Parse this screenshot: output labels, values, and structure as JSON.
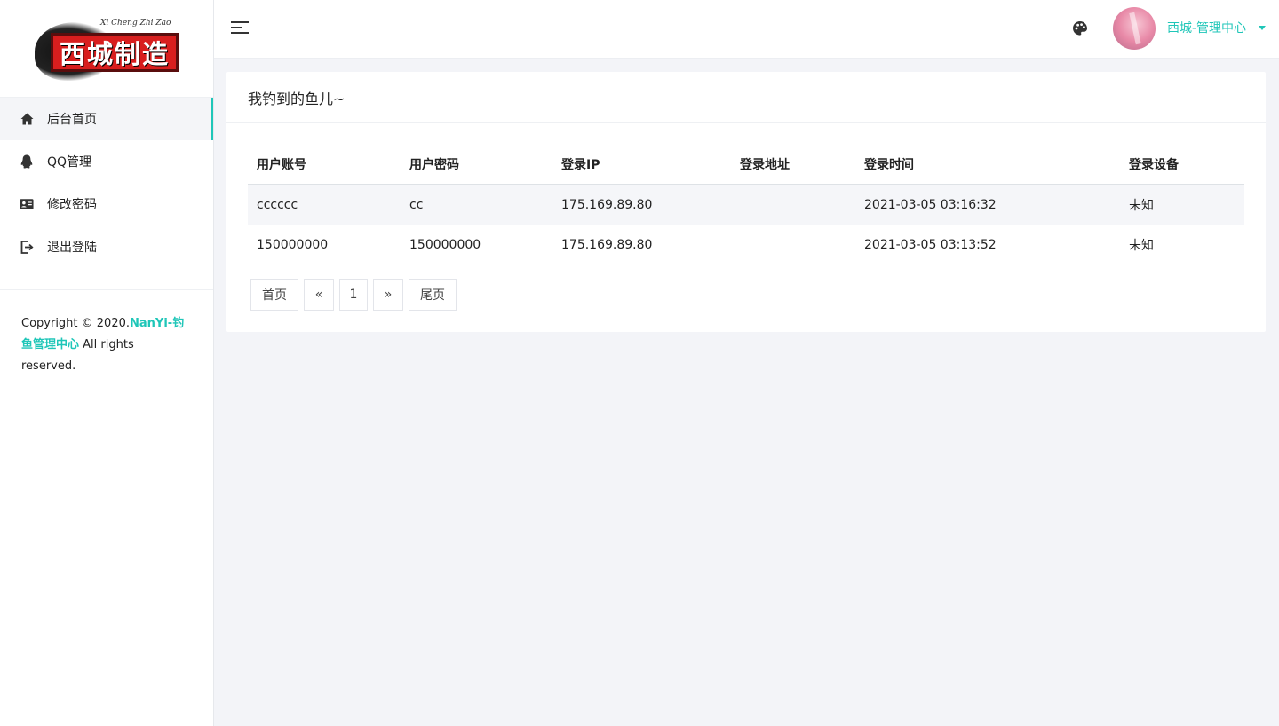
{
  "logo": {
    "text": "西城制造",
    "script": "Xi Cheng Zhi Zao"
  },
  "sidebar": {
    "items": [
      {
        "label": "后台首页",
        "icon": "home-icon"
      },
      {
        "label": "QQ管理",
        "icon": "qq-penguin-icon"
      },
      {
        "label": "修改密码",
        "icon": "id-card-icon"
      },
      {
        "label": "退出登陆",
        "icon": "logout-icon"
      }
    ],
    "copyright_prefix": "Copyright © 2020.",
    "copyright_brand": "NanYi-钓鱼管理中心",
    "copyright_suffix": " All rights reserved."
  },
  "header": {
    "menu_icon": "hamburger-menu-icon",
    "theme_icon": "palette-icon",
    "user_name": "西城-管理中心",
    "accent_color": "#1fc6b8"
  },
  "card": {
    "title": "我钓到的鱼儿~",
    "table": {
      "headers": [
        "用户账号",
        "用户密码",
        "登录IP",
        "登录地址",
        "登录时间",
        "登录设备"
      ],
      "rows": [
        [
          "cccccc",
          "cc",
          "175.169.89.80",
          "",
          "2021-03-05 03:16:32",
          "未知"
        ],
        [
          "150000000",
          "150000000",
          "175.169.89.80",
          "",
          "2021-03-05 03:13:52",
          "未知"
        ]
      ]
    },
    "pagination": {
      "first": "首页",
      "prev": "«",
      "page": "1",
      "next": "»",
      "last": "尾页"
    }
  }
}
